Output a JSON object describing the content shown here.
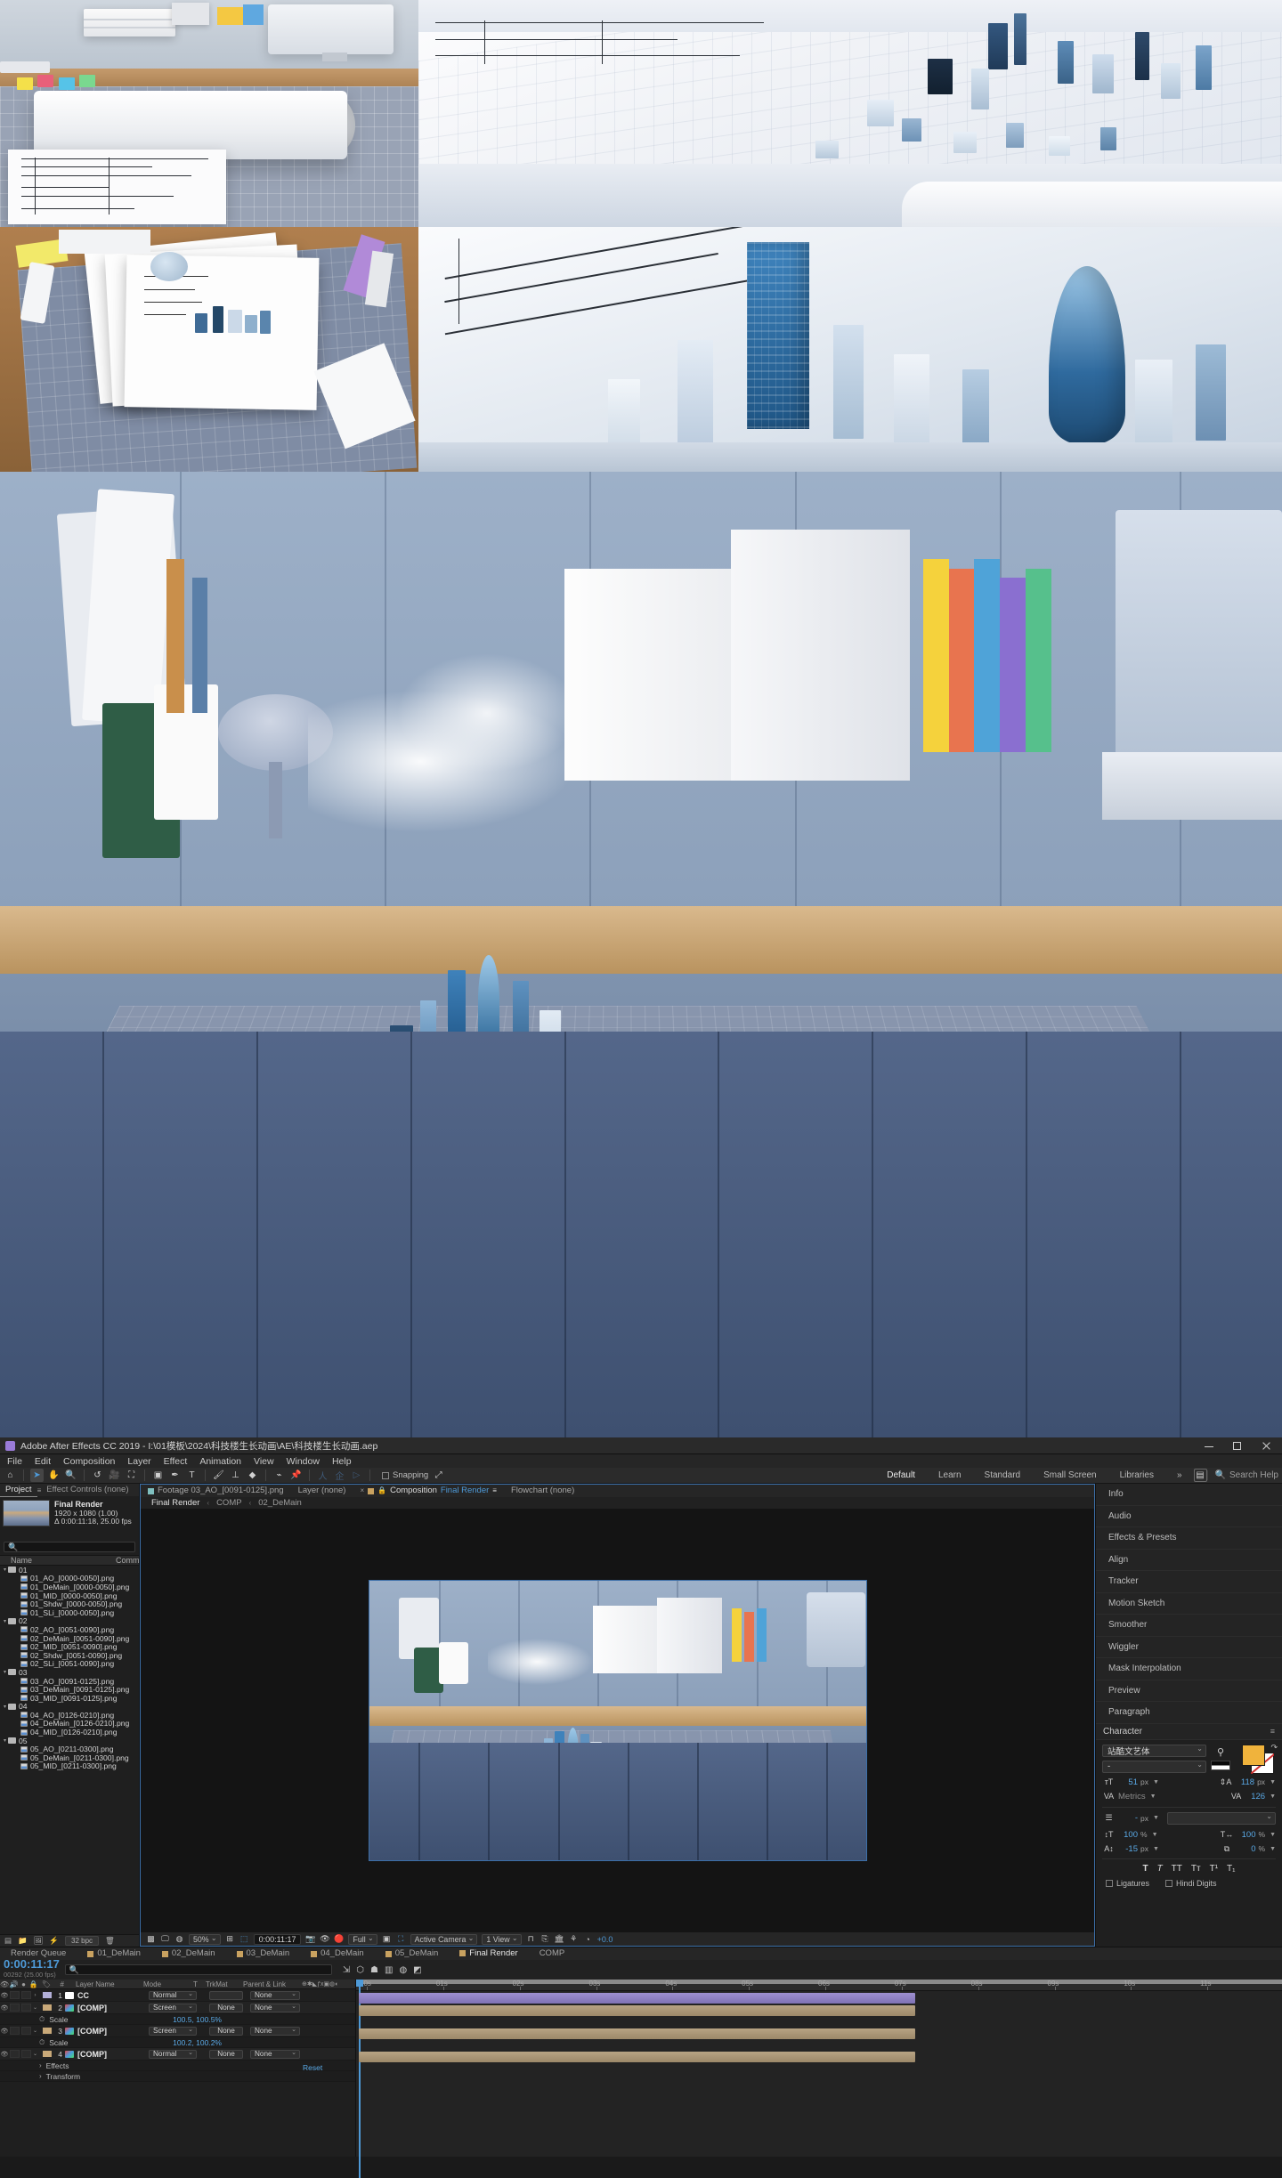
{
  "app": {
    "title": "Adobe After Effects CC 2019 - I:\\01模板\\2024\\科技楼生长动画\\AE\\科技楼生长动画.aep",
    "icon": "ae-app-icon"
  },
  "menu": [
    "File",
    "Edit",
    "Composition",
    "Layer",
    "Effect",
    "Animation",
    "View",
    "Window",
    "Help"
  ],
  "toolbar": {
    "tools": [
      {
        "name": "home-icon",
        "glyph": "⌂"
      },
      {
        "name": "selection-tool",
        "glyph": "➤"
      },
      {
        "name": "hand-tool",
        "glyph": "✋"
      },
      {
        "name": "zoom-tool",
        "glyph": "🔍"
      },
      {
        "name": "rotation-tool",
        "glyph": "↺"
      },
      {
        "name": "camera-tool",
        "glyph": "🎥"
      },
      {
        "name": "pan-behind-tool",
        "glyph": "✥"
      },
      {
        "name": "shape-tool",
        "glyph": "▢"
      },
      {
        "name": "pen-tool",
        "glyph": "✒"
      },
      {
        "name": "type-tool",
        "glyph": "T"
      },
      {
        "name": "brush-tool",
        "glyph": "✎"
      },
      {
        "name": "clone-stamp-tool",
        "glyph": "⊥"
      },
      {
        "name": "eraser-tool",
        "glyph": "◆"
      },
      {
        "name": "roto-brush-tool",
        "glyph": "⌇"
      },
      {
        "name": "puppet-pin-tool",
        "glyph": "📌"
      }
    ],
    "snapping_label": "Snapping"
  },
  "workspace": {
    "tabs": [
      "Default",
      "Learn",
      "Standard",
      "Small Screen",
      "Libraries"
    ],
    "selected": "Default",
    "overflow": "»",
    "search_help": "Search Help"
  },
  "project": {
    "tabs": [
      {
        "label": "Project",
        "selected": true
      },
      {
        "label": "Effect Controls (none)",
        "selected": false
      }
    ],
    "header": {
      "name": "Final Render",
      "dimensions": "1920 x 1080 (1.00)",
      "duration": "Δ 0:00:11:18, 25.00 fps"
    },
    "search_placeholder": "",
    "columns": [
      "Name",
      "Comm"
    ],
    "footer": {
      "bit_depth": "32 bpc"
    },
    "items": [
      {
        "type": "folder",
        "label": "01",
        "depth": 0
      },
      {
        "type": "footage",
        "label": "01_AO_[0000-0050].png",
        "depth": 1
      },
      {
        "type": "footage",
        "label": "01_DeMain_[0000-0050].png",
        "depth": 1
      },
      {
        "type": "footage",
        "label": "01_MID_[0000-0050].png",
        "depth": 1
      },
      {
        "type": "footage",
        "label": "01_Shdw_[0000-0050].png",
        "depth": 1
      },
      {
        "type": "footage",
        "label": "01_SLi_[0000-0050].png",
        "depth": 1
      },
      {
        "type": "folder",
        "label": "02",
        "depth": 0
      },
      {
        "type": "footage",
        "label": "02_AO_[0051-0090].png",
        "depth": 1
      },
      {
        "type": "footage",
        "label": "02_DeMain_[0051-0090].png",
        "depth": 1
      },
      {
        "type": "footage",
        "label": "02_MID_[0051-0090].png",
        "depth": 1
      },
      {
        "type": "footage",
        "label": "02_Shdw_[0051-0090].png",
        "depth": 1
      },
      {
        "type": "footage",
        "label": "02_SLi_[0051-0090].png",
        "depth": 1
      },
      {
        "type": "folder",
        "label": "03",
        "depth": 0
      },
      {
        "type": "footage",
        "label": "03_AO_[0091-0125].png",
        "depth": 1
      },
      {
        "type": "footage",
        "label": "03_DeMain_[0091-0125].png",
        "depth": 1
      },
      {
        "type": "footage",
        "label": "03_MID_[0091-0125].png",
        "depth": 1
      },
      {
        "type": "folder",
        "label": "04",
        "depth": 0
      },
      {
        "type": "footage",
        "label": "04_AO_[0126-0210].png",
        "depth": 1
      },
      {
        "type": "footage",
        "label": "04_DeMain_[0126-0210].png",
        "depth": 1
      },
      {
        "type": "footage",
        "label": "04_MID_[0126-0210].png",
        "depth": 1
      },
      {
        "type": "folder",
        "label": "05",
        "depth": 0
      },
      {
        "type": "footage",
        "label": "05_AO_[0211-0300].png",
        "depth": 1
      },
      {
        "type": "footage",
        "label": "05_DeMain_[0211-0300].png",
        "depth": 1
      },
      {
        "type": "footage",
        "label": "05_MID_[0211-0300].png",
        "depth": 1
      }
    ]
  },
  "viewer": {
    "tabs": [
      {
        "label": "Footage 03_AO_[0091-0125].png",
        "selected": false
      },
      {
        "label": "Layer (none)",
        "selected": false
      },
      {
        "label": "Composition",
        "name": "Final Render",
        "selected": true
      },
      {
        "label": "Flowchart (none)",
        "selected": false
      }
    ],
    "breadcrumb": [
      {
        "label": "Final Render",
        "selected": true
      },
      {
        "label": "COMP",
        "selected": false
      },
      {
        "label": "02_DeMain",
        "selected": false
      }
    ],
    "controls": {
      "magnification": "50%",
      "current_time": "0:00:11:17",
      "resolution": "Full",
      "view": "Active Camera",
      "view_layout": "1 View",
      "exposure": "+0.0"
    }
  },
  "right_dock": {
    "panels": [
      "Info",
      "Audio",
      "Effects & Presets",
      "Align",
      "Tracker",
      "Motion Sketch",
      "Smoother",
      "Wiggler",
      "Mask Interpolation",
      "Preview",
      "Paragraph"
    ],
    "character": {
      "title": "Character",
      "font_family": "站酷文艺体",
      "font_style": "-",
      "font_size": "51",
      "font_size_unit": "px",
      "leading": "118",
      "leading_unit": "px",
      "kerning": "Metrics",
      "tracking": "126",
      "stroke_width": "-",
      "stroke_width_unit": "px",
      "stroke_type": "",
      "vertical_scale": "100",
      "horizontal_scale": "100",
      "percent": "%",
      "baseline_shift": "-15",
      "baseline_unit": "px",
      "tsume": "0",
      "styles": [
        "T",
        "T",
        "TT",
        "Tт",
        "T¹",
        "T₁"
      ],
      "ligatures_label": "Ligatures",
      "hindi_label": "Hindi Digits",
      "fill_color": "#f0b33c",
      "stroke_color": "#ffffff"
    }
  },
  "timeline": {
    "tabs": [
      {
        "label": "Render Queue",
        "selected": false,
        "swatch": false
      },
      {
        "label": "01_DeMain",
        "selected": false,
        "swatch": true
      },
      {
        "label": "02_DeMain",
        "selected": false,
        "swatch": true
      },
      {
        "label": "03_DeMain",
        "selected": false,
        "swatch": true
      },
      {
        "label": "04_DeMain",
        "selected": false,
        "swatch": true
      },
      {
        "label": "05_DeMain",
        "selected": false,
        "swatch": true
      },
      {
        "label": "Final Render",
        "selected": true,
        "swatch": true
      },
      {
        "label": "COMP",
        "selected": false,
        "swatch": false
      }
    ],
    "current_time": "0:00:11:17",
    "frame_info": "00292 (25.00 fps)",
    "search_placeholder": "",
    "columns": [
      "#",
      "Layer Name",
      "Mode",
      "T",
      "TrkMat",
      "Parent & Link"
    ],
    "reset_label": "Reset",
    "ruler_ticks": [
      "00s",
      "01s",
      "02s",
      "03s",
      "04s",
      "05s",
      "06s",
      "07s",
      "08s",
      "09s",
      "10s",
      "11s"
    ],
    "layers": [
      {
        "index": "1",
        "name": "CC",
        "mode": "Normal",
        "trkmat": "",
        "parent": "None",
        "swatch": "#b3b0d8",
        "icon": "#ffffff",
        "sub": []
      },
      {
        "index": "2",
        "name": "[COMP]",
        "mode": "Screen",
        "trkmat": "None",
        "parent": "None",
        "swatch": "#c9a979",
        "icon": "multi",
        "sub": [
          {
            "label": "Scale",
            "value": "100.5, 100.5%"
          }
        ]
      },
      {
        "index": "3",
        "name": "[COMP]",
        "mode": "Screen",
        "trkmat": "None",
        "parent": "None",
        "swatch": "#c9a979",
        "icon": "multi",
        "sub": [
          {
            "label": "Scale",
            "value": "100.2, 100.2%"
          }
        ]
      },
      {
        "index": "4",
        "name": "[COMP]",
        "mode": "Normal",
        "trkmat": "None",
        "parent": "None",
        "swatch": "#c9a979",
        "icon": "multi",
        "sub": [
          {
            "label": "Effects",
            "value": ""
          },
          {
            "label": "Transform",
            "value": ""
          }
        ]
      }
    ]
  },
  "montage": {
    "panels": [
      {
        "name": "blueprint-roll-desk",
        "caption": ""
      },
      {
        "name": "blue-city-model-aerial",
        "caption": ""
      },
      {
        "name": "desk-overhead-drawings",
        "caption": ""
      },
      {
        "name": "towers-closeup-gherkin",
        "caption": ""
      },
      {
        "name": "hero-wide-desk-city",
        "caption": ""
      }
    ]
  }
}
